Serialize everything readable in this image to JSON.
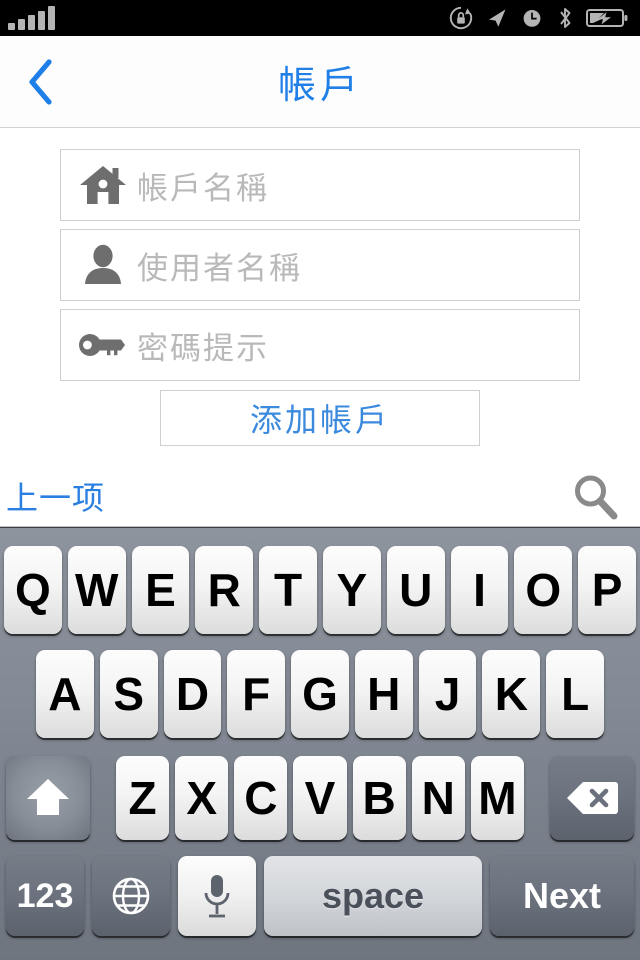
{
  "status_bar": {
    "signal_bars": 5,
    "icons": [
      "rotation-lock-icon",
      "location-arrow-icon",
      "alarm-clock-icon",
      "bluetooth-icon",
      "battery-charging-icon"
    ],
    "background_color": "#000000",
    "icon_color": "#b4b4b4"
  },
  "nav_bar": {
    "back_label": "",
    "title": "帳戶",
    "title_color": "#2180e8"
  },
  "form": {
    "fields": [
      {
        "icon": "house-icon",
        "placeholder": "帳戶名稱",
        "value": ""
      },
      {
        "icon": "person-icon",
        "placeholder": "使用者名稱",
        "value": ""
      },
      {
        "icon": "key-icon",
        "placeholder": "密碼提示",
        "value": ""
      }
    ],
    "add_button_label": "添加帳戶",
    "add_button_color": "#3b8ade"
  },
  "accessory_toolbar": {
    "prev_label": "上一项",
    "prev_color": "#2a7fe0",
    "search_icon": "search-icon"
  },
  "keyboard": {
    "row1": [
      "Q",
      "W",
      "E",
      "R",
      "T",
      "Y",
      "U",
      "I",
      "O",
      "P"
    ],
    "row2": [
      "A",
      "S",
      "D",
      "F",
      "G",
      "H",
      "J",
      "K",
      "L"
    ],
    "row3": [
      "Z",
      "X",
      "C",
      "V",
      "B",
      "N",
      "M"
    ],
    "shift_icon": "shift-arrow-icon",
    "delete_icon": "backspace-icon",
    "numeric_label": "123",
    "globe_icon": "globe-icon",
    "mic_icon": "microphone-icon",
    "space_label": "space",
    "return_label": "Next",
    "background_color": "#838a95"
  }
}
